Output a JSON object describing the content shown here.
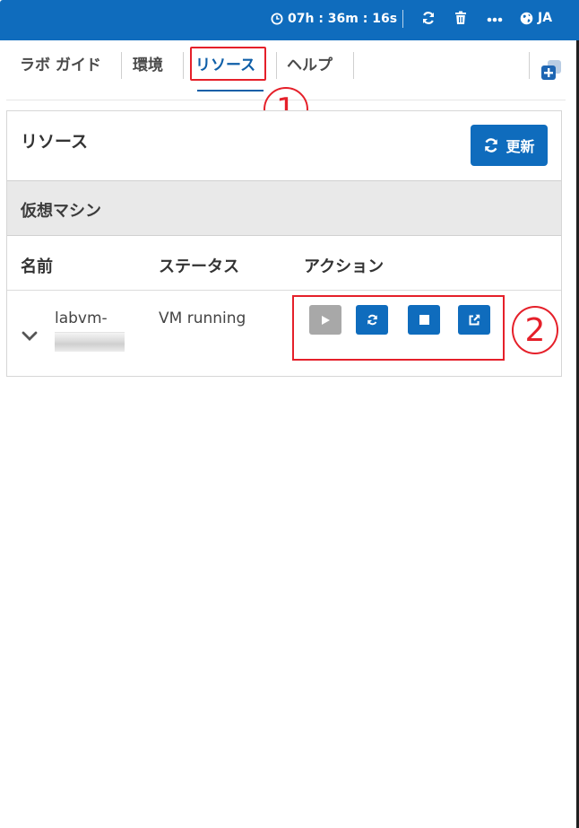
{
  "header": {
    "timer": "07h : 36m : 16s",
    "language": "JA",
    "icons": [
      "clock-icon",
      "refresh-icon",
      "trash-icon",
      "more-icon",
      "globe-icon"
    ],
    "accent_color": "#0f6cbd"
  },
  "tabs": [
    {
      "label": "ラボ ガイド",
      "active": false
    },
    {
      "label": "環境",
      "active": false
    },
    {
      "label": "リソース",
      "active": true
    },
    {
      "label": "ヘルプ",
      "active": false
    }
  ],
  "annotations": {
    "marker1": "1",
    "marker2": "2",
    "color": "#e5202a"
  },
  "resources": {
    "title": "リソース",
    "refresh_label": "更新",
    "section_title": "仮想マシン",
    "columns": [
      "名前",
      "ステータス",
      "アクション"
    ],
    "vms": [
      {
        "name": "labvm-",
        "status": "VM running",
        "actions": [
          "start-icon",
          "restart-icon",
          "stop-icon",
          "open-external-icon"
        ]
      }
    ]
  }
}
